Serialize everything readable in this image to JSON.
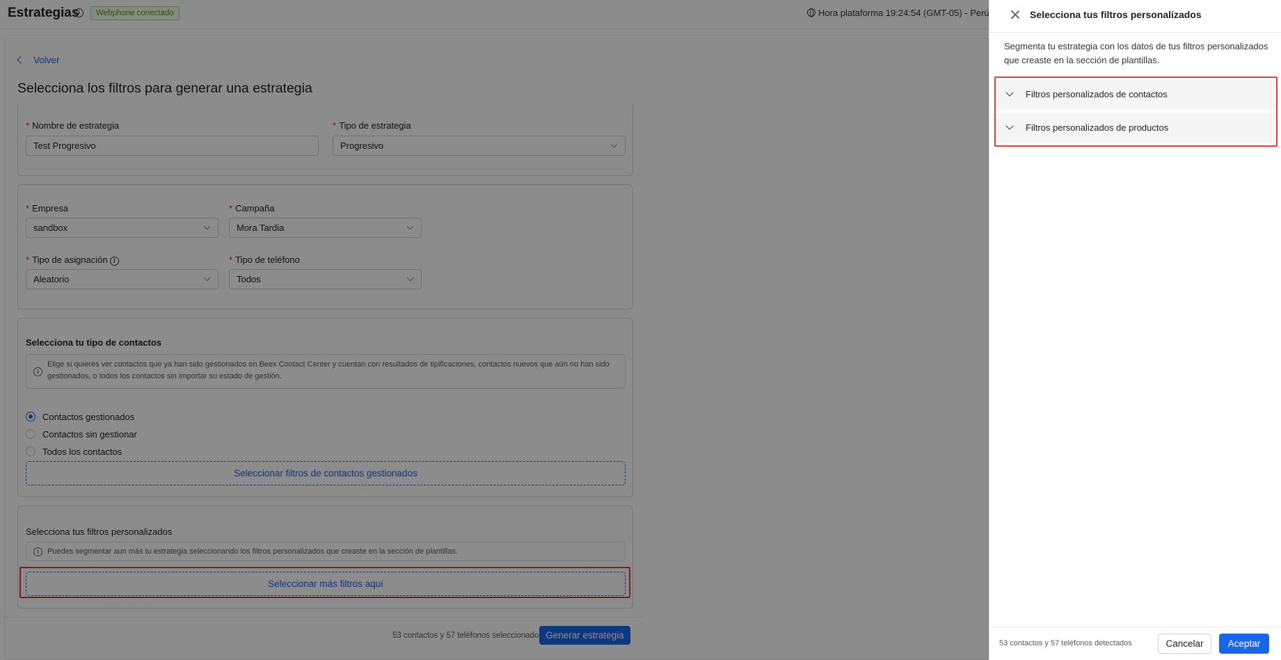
{
  "header": {
    "title": "Estrategias",
    "info_icon": "info-icon",
    "status_badge": "Webphone conectado",
    "platform_time": "Hora plataforma 19:24:54 (GMT-05) - Perú",
    "globe_icon": "globe-icon"
  },
  "main": {
    "back_label": "Volver",
    "title": "Selecciona los filtros para generar una estrategia",
    "strategy_name": {
      "label": "Nombre de estrategia",
      "value": "Test Progresivo"
    },
    "strategy_type": {
      "label": "Tipo de estrategia",
      "value": "Progresivo"
    },
    "company": {
      "label": "Empresa",
      "value": "sandbox"
    },
    "campaign": {
      "label": "Campaña",
      "value": "Mora Tardia"
    },
    "assignment_type": {
      "label": "Tipo de asignación",
      "value": "Aleatorio"
    },
    "phone_type": {
      "label": "Tipo de teléfono",
      "value": "Todos"
    },
    "contacts_section": {
      "title": "Selecciona tu tipo de contactos",
      "notice": "Elige si quieres ver contactos que ya han sido gestionados en Beex Contact Center y cuentan con resultados de tipificaciones, contactos nuevos que aún no han sido gestionados, o todos los contactos sin importar su estado de gestión.",
      "options": [
        {
          "label": "Contactos gestionados",
          "selected": true
        },
        {
          "label": "Contactos sin gestionar",
          "selected": false
        },
        {
          "label": "Todos los contactos",
          "selected": false
        }
      ],
      "filter_button": "Seleccionar filtros de contactos gestionados"
    },
    "custom_section": {
      "title": "Selecciona tus filtros personalizados",
      "notice": "Puedes segmentar aun más tu estrategia seleccionando los filtros personalizados que creaste en la sección de plantillas.",
      "more_button": "Seleccionar más filtros aquí"
    },
    "footer": {
      "count": "53 contactos y 57 teléfonos seleccionados",
      "generate_button": "Generar estrategia"
    }
  },
  "drawer": {
    "title": "Selecciona tus filtros personalizados",
    "description": "Segmenta tu estrategia con los datos de tus filtros personalizados que creaste en la sección de plantillas.",
    "accordions": [
      {
        "label": "Filtros personalizados de contactos"
      },
      {
        "label": "Filtros personalizados de productos"
      }
    ],
    "footer": {
      "count": "53 contactos y 57 teléfonos detectados",
      "cancel": "Cancelar",
      "accept": "Aceptar"
    }
  },
  "colors": {
    "primary": "#1966e8",
    "highlight": "#e53935",
    "badge_green": "#4b9b1f",
    "required": "#e02424"
  }
}
